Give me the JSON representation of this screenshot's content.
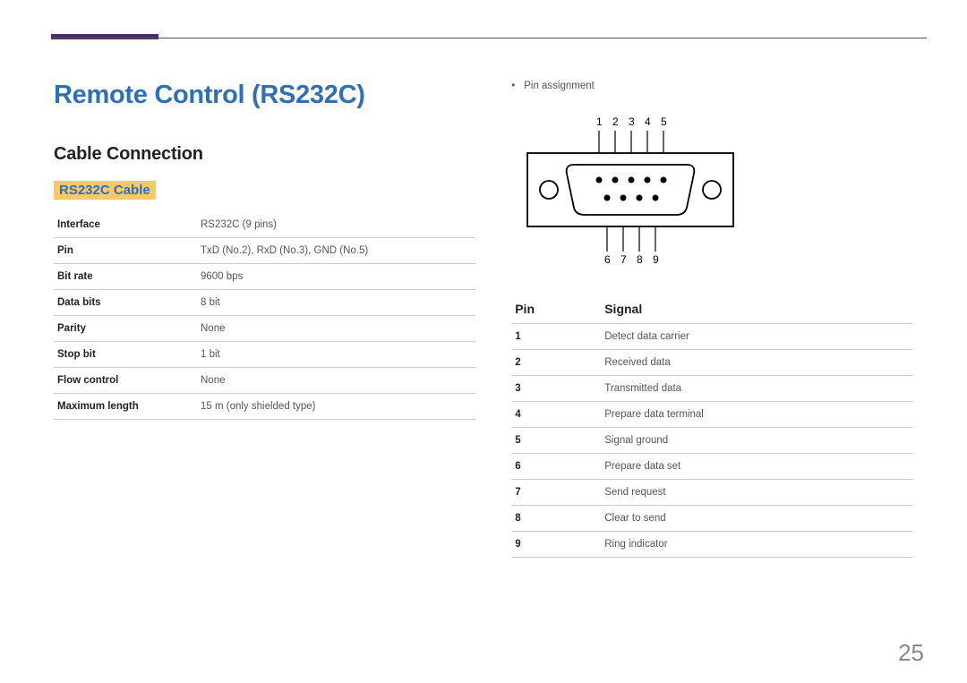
{
  "page": {
    "title": "Remote Control (RS232C)",
    "section": "Cable Connection",
    "subsection": "RS232C Cable",
    "page_number": "25"
  },
  "spec_table": [
    {
      "label": "Interface",
      "value": "RS232C (9 pins)"
    },
    {
      "label": "Pin",
      "value": "TxD (No.2), RxD (No.3), GND (No.5)"
    },
    {
      "label": "Bit rate",
      "value": "9600 bps"
    },
    {
      "label": "Data bits",
      "value": "8 bit"
    },
    {
      "label": "Parity",
      "value": "None"
    },
    {
      "label": "Stop bit",
      "value": "1 bit"
    },
    {
      "label": "Flow control",
      "value": "None"
    },
    {
      "label": "Maximum length",
      "value": "15 m (only shielded type)"
    }
  ],
  "right": {
    "bullet": "Pin assignment",
    "top_labels": "1  2  3  4  5",
    "bottom_labels": "6  7  8  9",
    "pin_header_left": "Pin",
    "pin_header_right": "Signal",
    "pins": [
      {
        "n": "1",
        "s": "Detect data carrier"
      },
      {
        "n": "2",
        "s": "Received data"
      },
      {
        "n": "3",
        "s": "Transmitted data"
      },
      {
        "n": "4",
        "s": "Prepare data terminal"
      },
      {
        "n": "5",
        "s": "Signal ground"
      },
      {
        "n": "6",
        "s": "Prepare data set"
      },
      {
        "n": "7",
        "s": "Send request"
      },
      {
        "n": "8",
        "s": "Clear to send"
      },
      {
        "n": "9",
        "s": "Ring indicator"
      }
    ]
  }
}
